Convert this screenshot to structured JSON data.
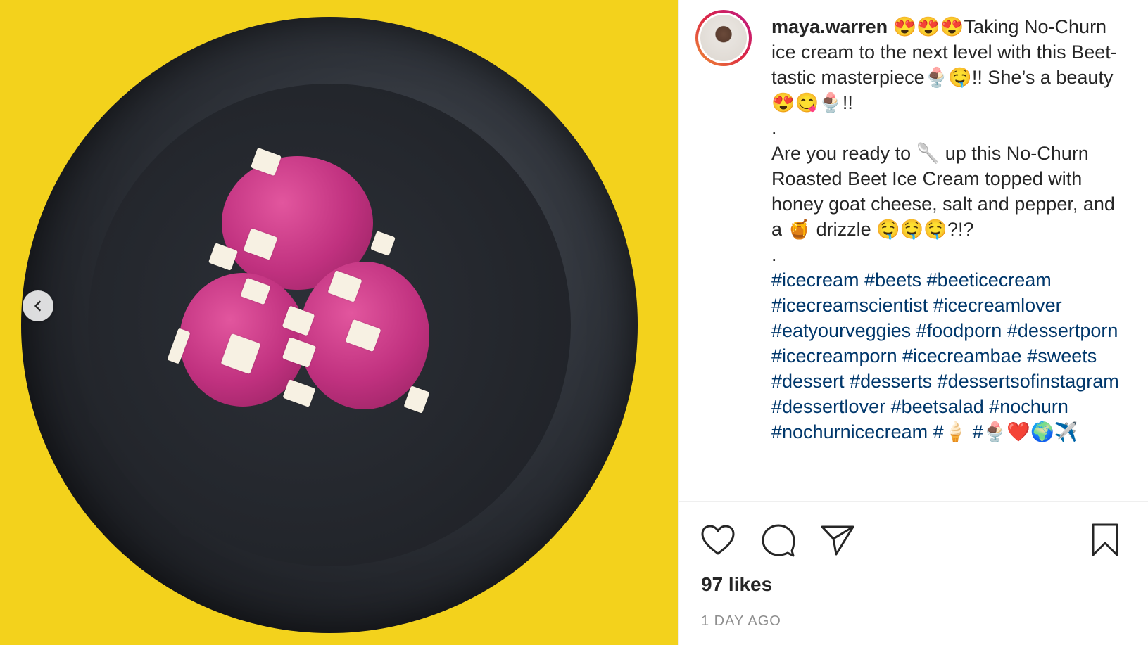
{
  "post": {
    "username": "maya.warren",
    "caption_lines": [
      "😍😍😍Taking No-Churn ice cream to the next level with this Beet-tastic masterpiece🍨🤤!! She’s a beauty 😍😋🍨!!",
      ".",
      "Are you ready to 🥄 up this No-Churn Roasted Beet Ice Cream topped with honey goat cheese, salt and pepper, and a 🍯 drizzle 🤤🤤🤤?!?",
      "."
    ],
    "hashtags": [
      "#icecream",
      "#beets",
      "#beeticecream",
      "#icecreamscientist",
      "#icecreamlover",
      "#eatyourveggies",
      "#foodporn",
      "#dessertporn",
      "#icecreamporn",
      "#icecreambae",
      "#sweets",
      "#dessert",
      "#desserts",
      "#dessertsofinstagram",
      "#dessertlover",
      "#beetsalad",
      "#nochurn",
      "#nochurnicecream",
      "#🍦",
      "#🍨❤️🌍✈️"
    ],
    "likes": "97 likes",
    "timestamp": "1 DAY AGO"
  },
  "icons": {
    "prev": "chevron-left-icon",
    "like": "heart-icon",
    "comment": "comment-bubble-icon",
    "share": "paper-plane-icon",
    "save": "bookmark-icon"
  },
  "colors": {
    "background_yellow": "#f3d21c",
    "hashtag_blue": "#00376b",
    "text": "#262626",
    "muted": "#8e8e8e"
  }
}
